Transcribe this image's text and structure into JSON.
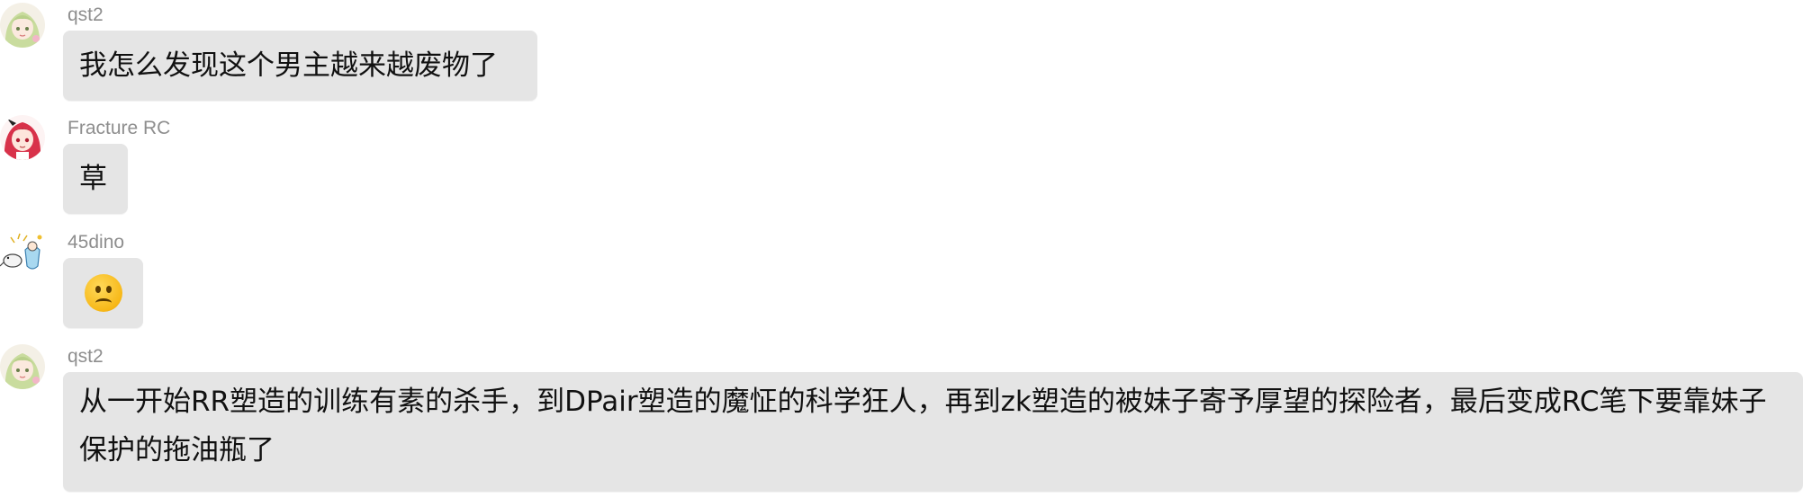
{
  "messages": [
    {
      "username": "qst2",
      "avatar": "anime-girl-green-hair-avatar",
      "text": "我怎么发现这个男主越来越废物了"
    },
    {
      "username": "Fracture RC",
      "avatar": "anime-girl-red-hair-avatar",
      "text": "草"
    },
    {
      "username": "45dino",
      "avatar": "dinosaur-sketch-avatar",
      "emoji": "frowning-face-emoji"
    },
    {
      "username": "qst2",
      "avatar": "anime-girl-green-hair-avatar",
      "text": "从一开始RR塑造的训练有素的杀手，到DPair塑造的魔怔的科学狂人，再到zk塑造的被妹子寄予厚望的探险者，最后变成RC笔下要靠妹子保护的拖油瓶了"
    }
  ],
  "colors": {
    "bubble_bg": "#e5e5e5",
    "username": "#8e8e8e",
    "text": "#111111"
  }
}
